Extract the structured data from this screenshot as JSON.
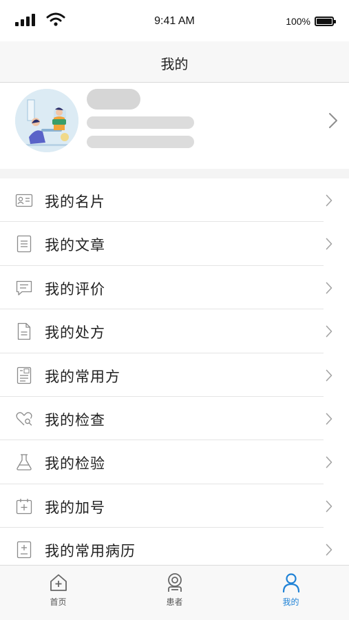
{
  "status_bar": {
    "time": "9:41 AM",
    "battery": "100%"
  },
  "header": {
    "title": "我的"
  },
  "menu": {
    "items": [
      {
        "label": "我的名片",
        "icon": "id-card-icon"
      },
      {
        "label": "我的文章",
        "icon": "article-icon"
      },
      {
        "label": "我的评价",
        "icon": "comment-icon"
      },
      {
        "label": "我的处方",
        "icon": "prescription-icon"
      },
      {
        "label": "我的常用方",
        "icon": "common-prescription-icon"
      },
      {
        "label": "我的检查",
        "icon": "examination-icon"
      },
      {
        "label": "我的检验",
        "icon": "flask-icon"
      },
      {
        "label": "我的加号",
        "icon": "calendar-plus-icon"
      },
      {
        "label": "我的常用病历",
        "icon": "medical-record-icon"
      }
    ]
  },
  "tab_bar": {
    "items": [
      {
        "label": "首页",
        "icon": "home-icon",
        "active": false
      },
      {
        "label": "患者",
        "icon": "patient-icon",
        "active": false
      },
      {
        "label": "我的",
        "icon": "user-icon",
        "active": true
      }
    ]
  },
  "colors": {
    "accent": "#1f82d6",
    "placeholder": "#d6d6d6",
    "icon_gray": "#8a8a8a"
  }
}
